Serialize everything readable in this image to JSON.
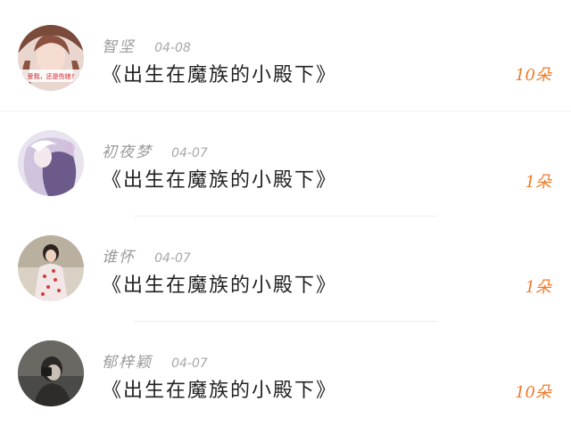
{
  "colors": {
    "accent": "#f07a2a",
    "divider": "#eeeeee"
  },
  "items": [
    {
      "user": "智坚",
      "date": "04-08",
      "book": "《出生在魔族的小殿下》",
      "count": "10朵",
      "avatar_caption": "爱我，还是伤她?"
    },
    {
      "user": "初夜梦",
      "date": "04-07",
      "book": "《出生在魔族的小殿下》",
      "count": "1朵"
    },
    {
      "user": "谁怀",
      "date": "04-07",
      "book": "《出生在魔族的小殿下》",
      "count": "1朵"
    },
    {
      "user": "郁梓颖",
      "date": "04-07",
      "book": "《出生在魔族的小殿下》",
      "count": "10朵"
    }
  ]
}
